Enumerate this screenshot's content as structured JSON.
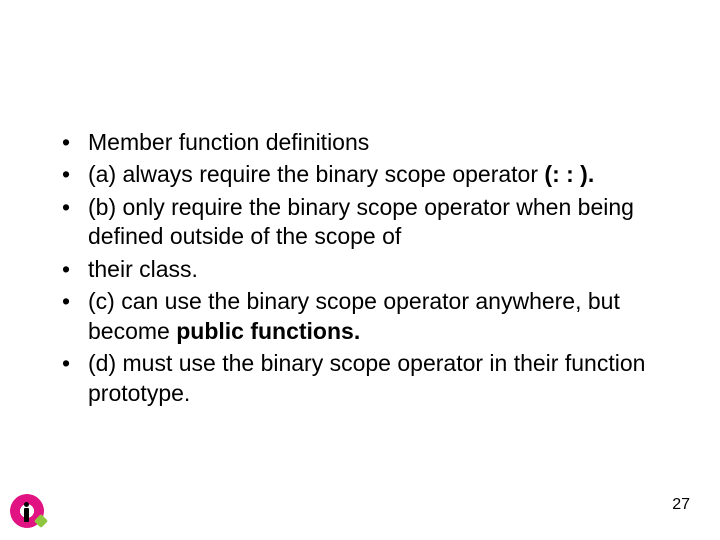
{
  "bullets": {
    "b0": "Member function definitions",
    "b1_pre": "(a) always require the binary scope operator ",
    "b1_bold": "(: : ).",
    "b2": "(b) only require the binary scope operator when being defined outside of the scope of",
    "b3": "their class.",
    "b4_pre": "(c) can use the binary scope operator anywhere, but become ",
    "b4_bold": "public functions.",
    "b5": "(d) must use the binary scope operator in their function prototype."
  },
  "page_number": "27"
}
